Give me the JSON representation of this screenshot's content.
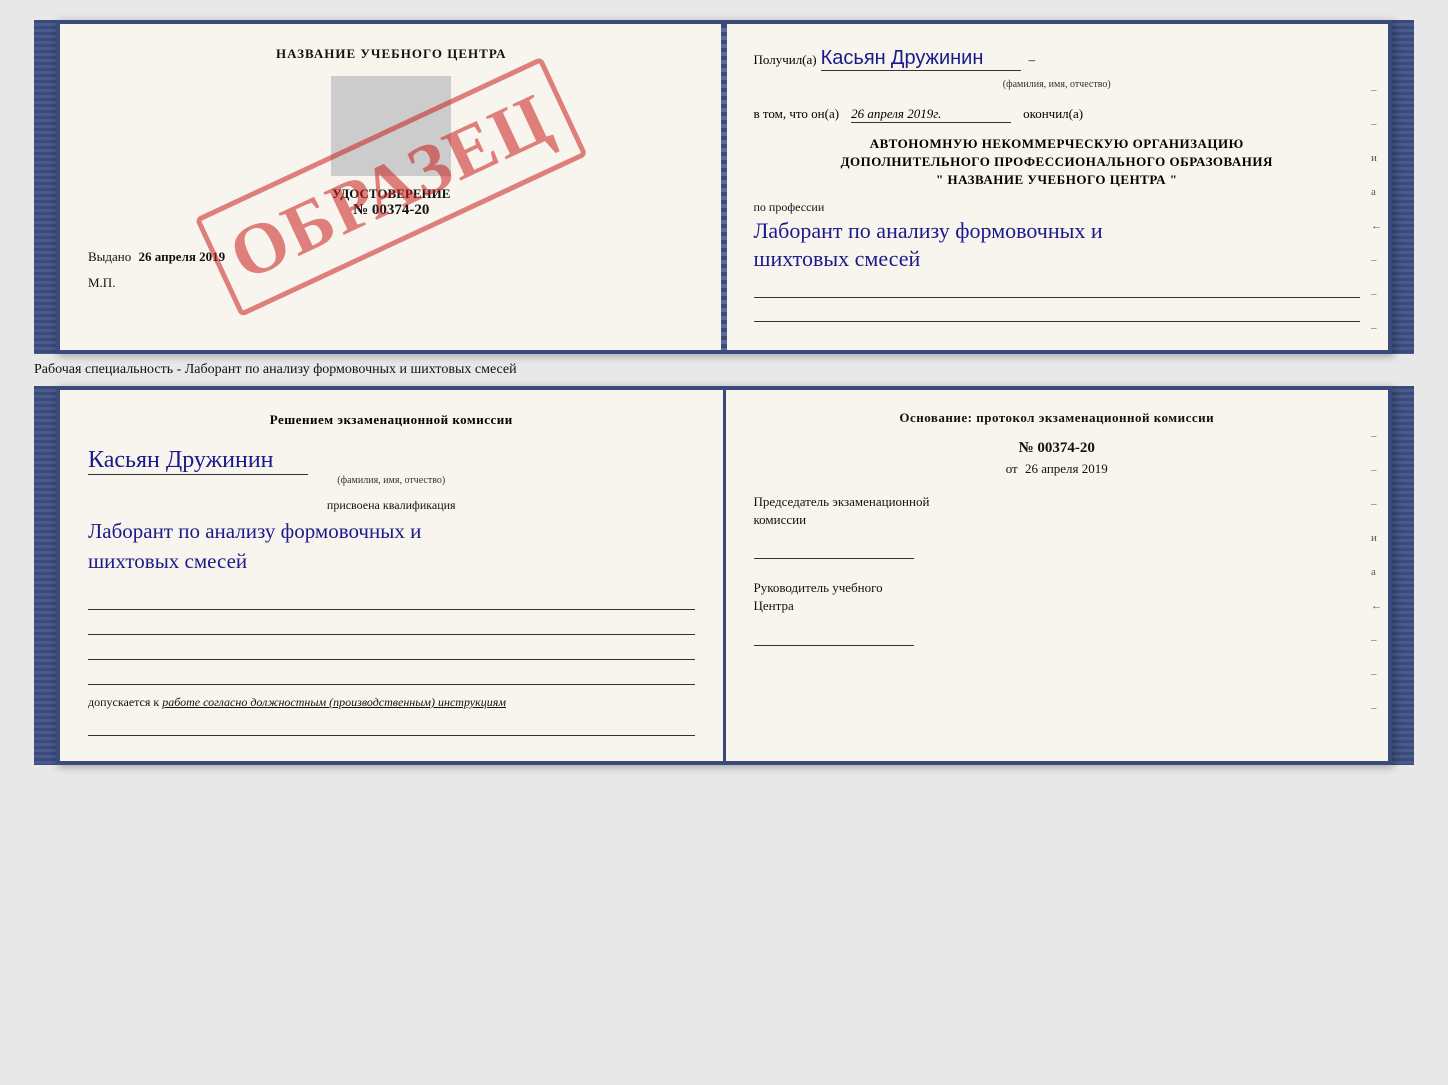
{
  "top_book": {
    "left": {
      "title": "НАЗВАНИЕ УЧЕБНОГО ЦЕНТРА",
      "stamp": "ОБРАЗЕЦ",
      "doc_label": "УДОСТОВЕРЕНИЕ",
      "doc_number": "№ 00374-20",
      "issued_label": "Выдано",
      "issued_date": "26 апреля 2019",
      "mp": "М.П."
    },
    "right": {
      "received_label": "Получил(а)",
      "received_name": "Касьян Дружинин",
      "name_subtext": "(фамилия, имя, отчество)",
      "in_that_label": "в том, что он(а)",
      "date_value": "26 апреля 2019г.",
      "finished_label": "окончил(а)",
      "org_line1": "АВТОНОМНУЮ НЕКОММЕРЧЕСКУЮ ОРГАНИЗАЦИЮ",
      "org_line2": "ДОПОЛНИТЕЛЬНОГО ПРОФЕССИОНАЛЬНОГО ОБРАЗОВАНИЯ",
      "org_line3": "\"   НАЗВАНИЕ УЧЕБНОГО ЦЕНТРА   \"",
      "prof_label": "по профессии",
      "profession_line1": "Лаборант по анализу формовочных и",
      "profession_line2": "шихтовых смесей",
      "side_letters": "и а ←"
    }
  },
  "specialty_bar": {
    "text": "Рабочая специальность - Лаборант по анализу формовочных и шихтовых смесей"
  },
  "bottom_book": {
    "left": {
      "commission_text": "Решением экзаменационной комиссии",
      "name_handwritten": "Касьян Дружинин",
      "name_subtext": "(фамилия, имя, отчество)",
      "qualification_label": "присвоена квалификация",
      "qualification_line1": "Лаборант по анализу формовочных и",
      "qualification_line2": "шихтовых смесей",
      "dopusk_prefix": "допускается к",
      "dopusk_text": "работе согласно должностным (производственным) инструкциям"
    },
    "right": {
      "osnov_label": "Основание: протокол экзаменационной комиссии",
      "protocol_number": "№ 00374-20",
      "date_prefix": "от",
      "date_value": "26 апреля 2019",
      "chairman_line1": "Председатель экзаменационной",
      "chairman_line2": "комиссии",
      "head_line1": "Руководитель учебного",
      "head_line2": "Центра",
      "side_letters": "и а ←"
    }
  }
}
